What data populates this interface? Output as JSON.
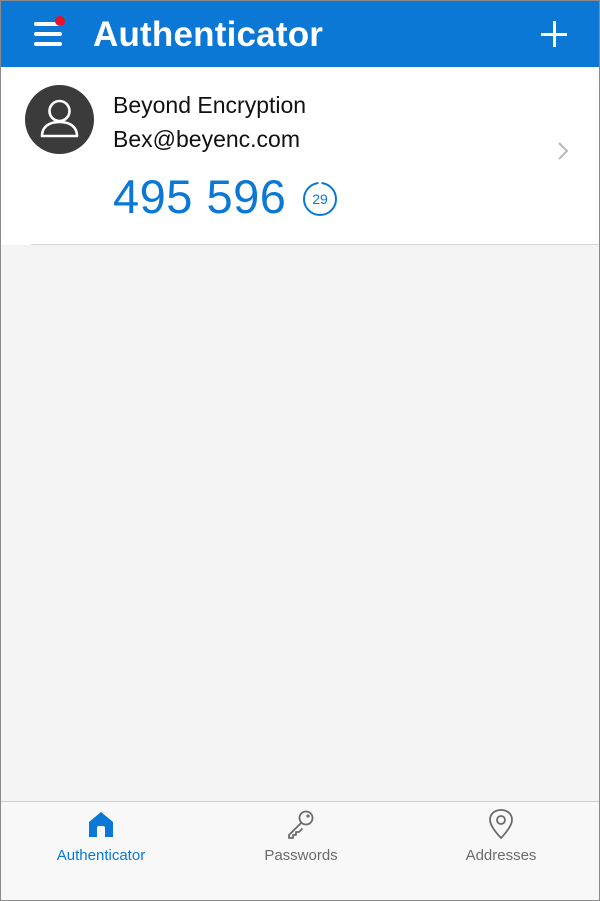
{
  "header": {
    "title": "Authenticator",
    "menu_icon": "hamburger-menu-icon",
    "notification_dot_color": "#e8102a",
    "add_icon": "plus-icon",
    "background_color": "#0a78d4"
  },
  "accounts": [
    {
      "name": "Beyond Encryption",
      "email": "Bex@beyenc.com",
      "code": "495 596",
      "seconds_remaining": "29",
      "avatar_icon": "user-avatar-icon",
      "chevron_icon": "chevron-right-icon"
    }
  ],
  "tabs": [
    {
      "label": "Authenticator",
      "icon": "home-icon",
      "active": true
    },
    {
      "label": "Passwords",
      "icon": "key-icon",
      "active": false
    },
    {
      "label": "Addresses",
      "icon": "location-pin-icon",
      "active": false
    }
  ],
  "colors": {
    "accent": "#0a78d4",
    "inactive_tab": "#6b6b6b",
    "avatar_background": "#3b3b3b"
  }
}
